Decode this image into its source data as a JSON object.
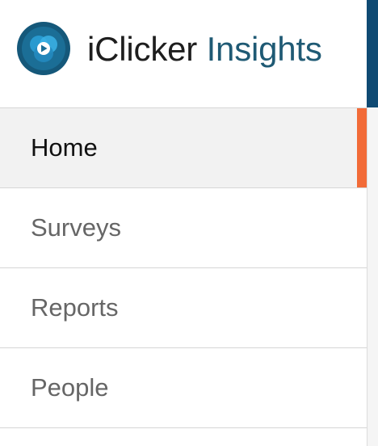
{
  "brand": {
    "primary": "iClicker",
    "secondary": "Insights",
    "logo_icon": "iclicker-logo-icon",
    "colors": {
      "primary_text": "#1e1e1e",
      "secondary_text": "#1f5a74",
      "logo_outer": "#15587a",
      "logo_inner": "#2a9fd6"
    }
  },
  "nav": {
    "items": [
      {
        "label": "Home",
        "active": true
      },
      {
        "label": "Surveys",
        "active": false
      },
      {
        "label": "Reports",
        "active": false
      },
      {
        "label": "People",
        "active": false
      }
    ],
    "active_indicator_color": "#f26b38"
  },
  "header_accent_color": "#0f4a73"
}
